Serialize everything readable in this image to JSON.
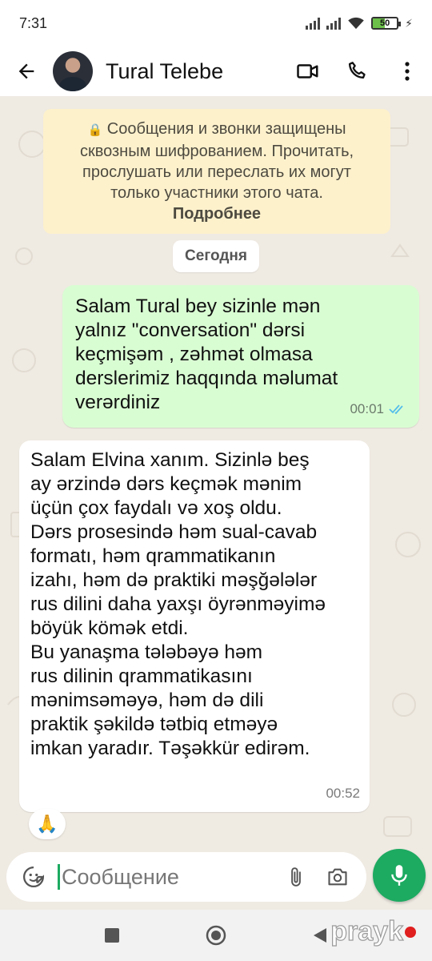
{
  "status_bar": {
    "time": "7:31",
    "battery": "50",
    "battery_fraction": 0.5,
    "icons": [
      "signal-icon",
      "signal-icon",
      "wifi-icon",
      "battery-icon",
      "charging-icon"
    ]
  },
  "header": {
    "contact_name": "Tural Telebe",
    "icons": [
      "back-arrow-icon",
      "avatar",
      "video-call-icon",
      "phone-icon",
      "more-vertical-icon"
    ]
  },
  "encryption_notice": {
    "text": "Сообщения и звонки защищены сквозным шифрованием. Прочитать, прослушать или переслать их могут только участники этого чата.",
    "link": "Подробнее"
  },
  "date_chip": "Сегодня",
  "messages": [
    {
      "direction": "outgoing",
      "text": "Salam Tural bey sizinle mən\nyalnız \"conversation\" dərsi\nkeçmişəm , zəhmət olmasa\nderslerimiz haqqında məlumat\nverərdiniz",
      "time": "00:01",
      "status": "read"
    },
    {
      "direction": "incoming",
      "text": "Salam Elvina xanım. Sizinlə beş\nay ərzində dərs keçmək mənim\nüçün çox faydalı və xoş oldu.\nDərs prosesində həm sual-cavab\nformatı, həm qrammatikanın\nizahı, həm də praktiki məşğələlər\nrus dilini daha yaxşı öyrənməyimə\nböyük kömək etdi.\nBu yanaşma tələbəyə həm\nrus dilinin qrammatikasını\nmənimsəməyə, həm də dili\npraktik şəkildə tətbiq etməyə\nimkan yaradır. Təşəkkür edirəm.",
      "time": "00:52",
      "reaction": "🙏"
    }
  ],
  "composer": {
    "placeholder": "Сообщение",
    "icons": [
      "emoji-icon",
      "attach-icon",
      "camera-icon",
      "mic-icon"
    ]
  },
  "nav_bar": {
    "icons": [
      "recents-icon",
      "home-icon",
      "back-icon"
    ]
  },
  "watermark": "prayk",
  "colors": {
    "outgoing_bubble": "#d9fdd3",
    "incoming_bubble": "#ffffff",
    "notice_bg": "#fdf1cc",
    "accent_green": "#1daa61",
    "read_ticks": "#53bdeb",
    "chat_bg": "#efeae2"
  }
}
